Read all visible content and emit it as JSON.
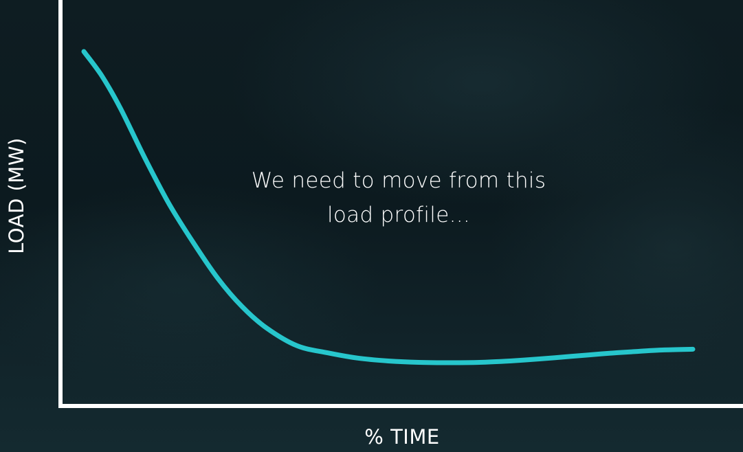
{
  "colors": {
    "curve": "#27c6cc",
    "axis": "#ffffff",
    "text": "#ffffff",
    "background": "#0c1a1f"
  },
  "annotation": {
    "line1": "We need to move from this",
    "line2": "load profile..."
  },
  "chart_data": {
    "type": "line",
    "title": "",
    "xlabel": "% TIME",
    "ylabel": "LOAD (MW)",
    "xlim": [
      0,
      100
    ],
    "ylim": [
      0,
      100
    ],
    "grid": false,
    "legend": "none",
    "tick_labels": false,
    "series": [
      {
        "x": [
          0,
          3,
          6,
          10,
          14,
          18,
          22,
          26,
          30,
          35,
          40,
          45,
          50,
          55,
          60,
          65,
          70,
          75,
          80,
          85,
          90,
          95,
          100
        ],
        "y": [
          100,
          93,
          84,
          70,
          57,
          46,
          36,
          28,
          22,
          17,
          15,
          13.5,
          12.7,
          12.3,
          12.2,
          12.3,
          12.7,
          13.3,
          14,
          14.7,
          15.3,
          15.8,
          16
        ]
      }
    ]
  }
}
